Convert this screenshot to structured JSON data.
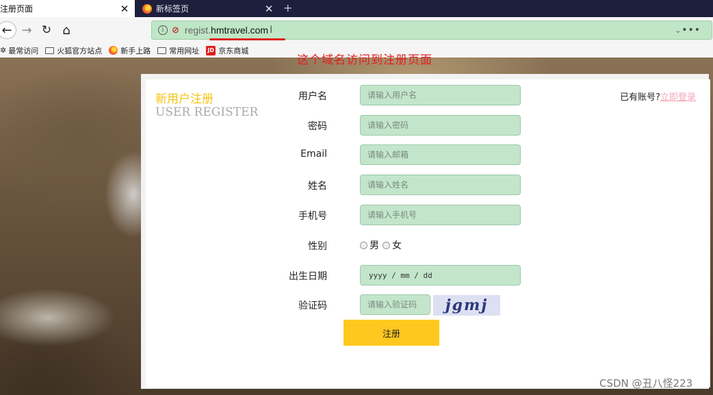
{
  "browser": {
    "tabs": [
      {
        "title": "注册页面",
        "close": "✕"
      },
      {
        "title": "新标签页",
        "close": "✕"
      }
    ],
    "new_tab_symbol": "+",
    "nav": {
      "back_icon": "←",
      "forward_icon": "→",
      "reload_icon": "↻",
      "home_icon": "⌂"
    },
    "url": {
      "prefix": "regist.",
      "domain": "hmtravel.com",
      "info_icon": "i",
      "dropdown_icon": "⌄",
      "more_icon": "•••"
    },
    "bookmarks": [
      "最常访问",
      "火狐官方站点",
      "新手上路",
      "常用网址",
      "京东商城"
    ],
    "bookmark_icons": {
      "jd": "JD"
    }
  },
  "annotation": "这个域名访问到注册页面",
  "register": {
    "title_cn": "新用户注册",
    "title_en": "USER REGISTER",
    "fields": [
      {
        "label": "用户名",
        "placeholder": "请输入用户名"
      },
      {
        "label": "密码",
        "placeholder": "请输入密码"
      },
      {
        "label": "Email",
        "placeholder": "请输入邮箱"
      },
      {
        "label": "姓名",
        "placeholder": "请输入姓名"
      },
      {
        "label": "手机号",
        "placeholder": "请输入手机号"
      }
    ],
    "gender": {
      "label": "性别",
      "options": [
        "男",
        "女"
      ]
    },
    "birthday": {
      "label": "出生日期",
      "value": "yyyy / mm / dd"
    },
    "captcha": {
      "label": "验证码",
      "placeholder": "请输入验证码",
      "image_text": "jgmj"
    },
    "submit_label": "注册",
    "login_hint": "已有账号?",
    "login_link": "立即登录"
  },
  "watermark": "CSDN @丑八怪223",
  "colors": {
    "input_bg": "#c3e6cb",
    "title_cn": "#f5c518",
    "submit_bg": "#ffc81f",
    "login_link": "#f4a6b7",
    "annotation": "#e02020"
  }
}
